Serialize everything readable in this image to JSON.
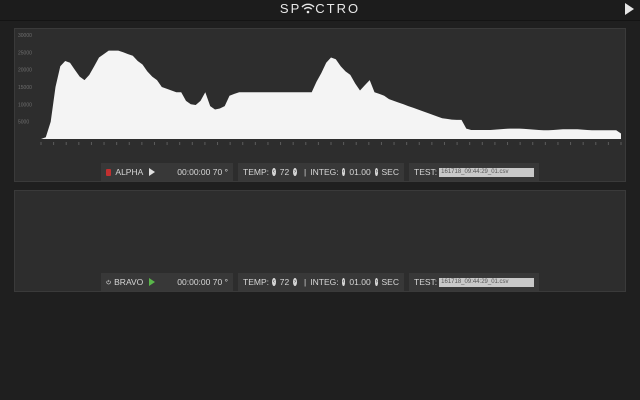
{
  "app": {
    "title_left": "SP",
    "title_right": "CTRO",
    "logo_icon": "wifi-icon",
    "play_icon": "play-icon"
  },
  "colors": {
    "background": "#1f1f1f",
    "panel": "#2d2d2d",
    "plot_fill": "#f4f4f4",
    "record": "#c23030",
    "bravo_play": "#59b64a"
  },
  "chart_data": {
    "type": "area",
    "title": "",
    "xlabel": "",
    "ylabel": "",
    "ylim": [
      0,
      30000
    ],
    "yticks": [
      5000,
      10000,
      15000,
      20000,
      25000,
      30000
    ],
    "xtick_count": 47,
    "grid": false,
    "series": [
      {
        "values": [
          0,
          500,
          5000,
          15000,
          21000,
          22500,
          22000,
          20000,
          18000,
          17000,
          18500,
          21000,
          23500,
          24500,
          25500,
          25500,
          25500,
          25000,
          24500,
          24000,
          22500,
          21500,
          19500,
          18000,
          17000,
          15000,
          14500,
          14000,
          13500,
          13500,
          11000,
          10000,
          9800,
          11000,
          13500,
          9500,
          8500,
          8800,
          9500,
          12500,
          13000,
          13500,
          13500,
          13500,
          13500,
          13500,
          13500,
          13500,
          13500,
          13500,
          13500,
          13500,
          13500,
          13500,
          13500,
          13500,
          13500,
          16500,
          19000,
          22000,
          23500,
          23000,
          21000,
          19500,
          18500,
          16000,
          14000,
          15500,
          17000,
          13500,
          13000,
          12500,
          11500,
          11000,
          10500,
          10000,
          9500,
          9000,
          8500,
          8000,
          7500,
          7000,
          6500,
          6000,
          5800,
          5600,
          5500,
          5500,
          3000,
          2600,
          2600,
          2600,
          2600,
          2600,
          2700,
          2800,
          2900,
          3000,
          3000,
          3000,
          2900,
          2800,
          2700,
          2600,
          2500,
          2500,
          2600,
          2700,
          2800,
          2800,
          2800,
          2800,
          2700,
          2600,
          2500,
          2500,
          2500,
          2500,
          2500,
          2500,
          1600
        ]
      }
    ]
  },
  "alpha": {
    "name": "ALPHA",
    "time": "00:00:00",
    "value": "70",
    "unit": "°",
    "temp_label": "TEMP:",
    "temp_value": "72",
    "integ_label": "INTEG:",
    "integ_value": "01.00",
    "integ_unit": "SEC",
    "test_label": "TEST:",
    "test_file": "161718_09:44:29_01.csv"
  },
  "bravo": {
    "name": "BRAVO",
    "time": "00:00:00",
    "value": "70",
    "unit": "°",
    "temp_label": "TEMP:",
    "temp_value": "72",
    "integ_label": "INTEG:",
    "integ_value": "01.00",
    "integ_unit": "SEC",
    "test_label": "TEST:",
    "test_file": "161718_09:44:29_01.csv"
  },
  "controls": {
    "decrement_glyph": "‹",
    "increment_glyph": "›"
  }
}
